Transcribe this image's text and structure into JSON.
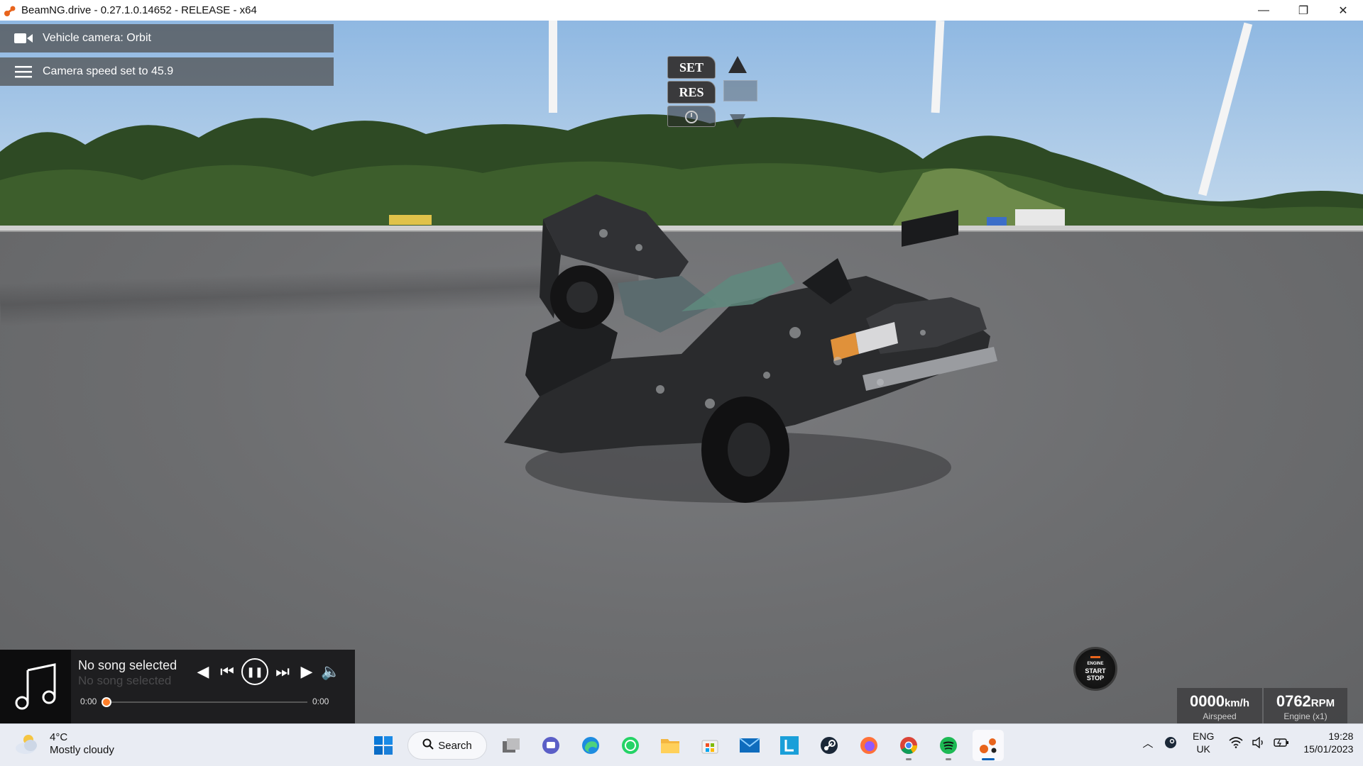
{
  "window": {
    "title": "BeamNG.drive - 0.27.1.0.14652 - RELEASE - x64",
    "app_icon": "beamng-icon",
    "controls": [
      "minimize",
      "restore",
      "close"
    ]
  },
  "notifications": [
    {
      "icon": "video-camera-icon",
      "text": "Vehicle camera: Orbit"
    },
    {
      "icon": "menu-icon",
      "text": "Camera speed set to 45.9"
    }
  ],
  "cruise_control": {
    "set_label": "SET",
    "res_label": "RES",
    "icons": [
      "arrow-up-icon",
      "arrow-down-icon",
      "speedometer-icon"
    ]
  },
  "music_player": {
    "title": "No song selected",
    "subtitle": "No song selected",
    "time_current": "0:00",
    "time_total": "0:00",
    "progress": 0,
    "icons": [
      "music-note-icon",
      "skip-back-icon",
      "previous-icon",
      "pause-icon",
      "next-icon",
      "skip-forward-icon",
      "volume-icon"
    ]
  },
  "engine_button": {
    "line1": "ENGINE",
    "line2": "START",
    "line3": "STOP"
  },
  "gauges": {
    "speed_value": "0000",
    "speed_unit": "km/h",
    "speed_label": "Airspeed",
    "rpm_value": "0762",
    "rpm_unit": "RPM",
    "rpm_label": "Engine (x1)"
  },
  "taskbar": {
    "weather_temp": "4°C",
    "weather_condition": "Mostly cloudy",
    "search_label": "Search",
    "apps": [
      "windows-start-icon",
      "search-icon",
      "task-view-icon",
      "teams-chat-icon",
      "edge-icon",
      "whatsapp-icon",
      "file-explorer-icon",
      "microsoft-store-icon",
      "mail-icon",
      "l-app-icon",
      "steam-icon",
      "firefox-icon",
      "chrome-icon",
      "spotify-icon",
      "beamng-icon"
    ],
    "tray_lang_1": "ENG",
    "tray_lang_2": "UK",
    "time": "19:28",
    "date": "15/01/2023"
  },
  "colors": {
    "accent_orange": "#ff7f2a",
    "taskbar_active": "#005fb8",
    "player_bg": "#18181a"
  }
}
